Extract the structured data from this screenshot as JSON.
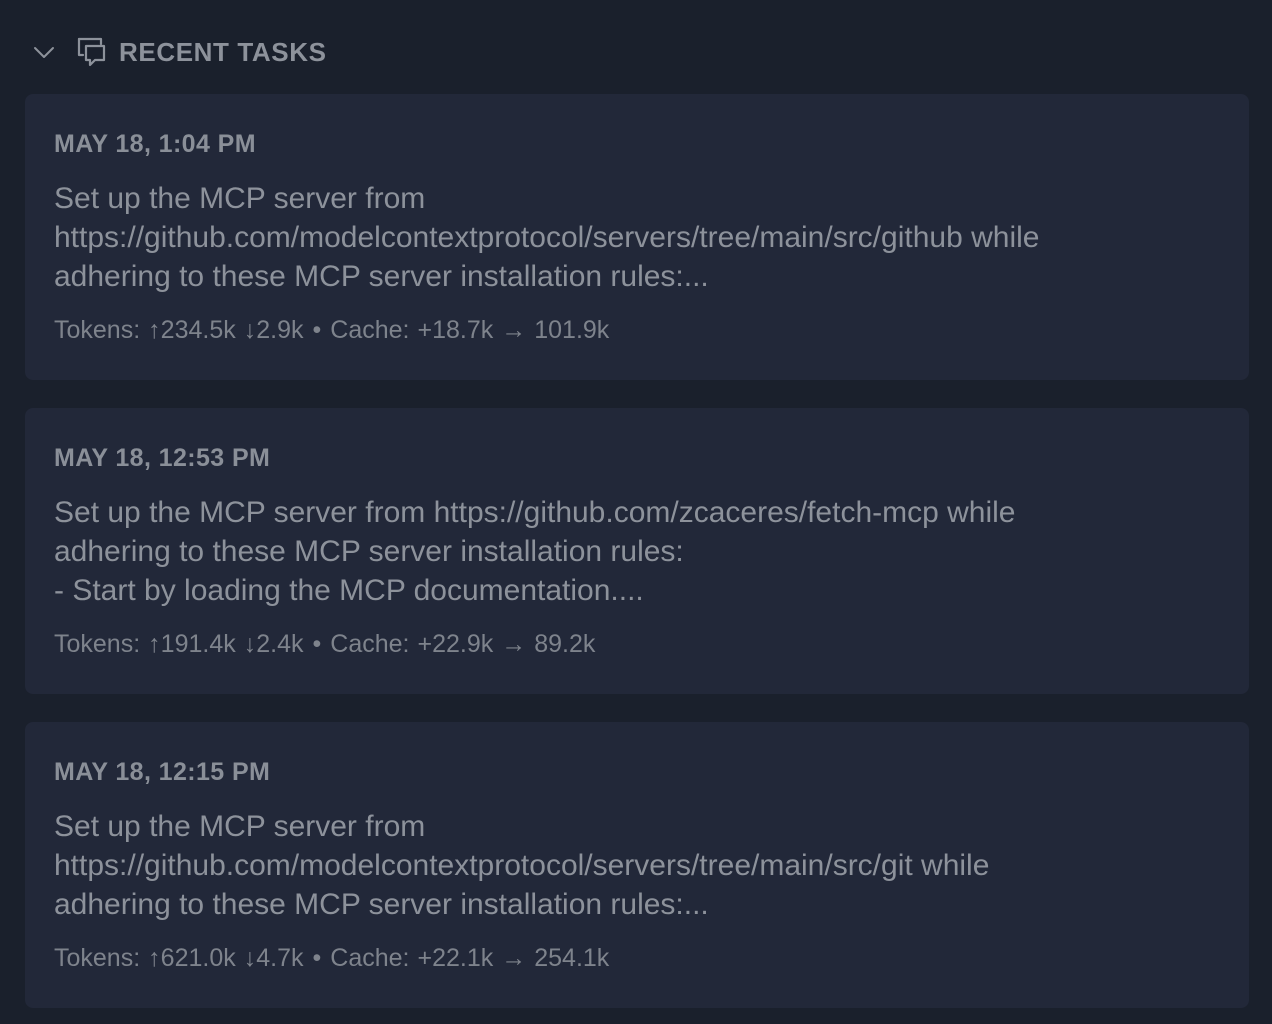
{
  "section": {
    "title": "RECENT TASKS",
    "chevron_icon": "chevron-down-icon",
    "chat_icon": "chat-bubbles-icon"
  },
  "tasks": [
    {
      "date": "MAY 18, 1:04 PM",
      "text": "Set up the MCP server from\nhttps://github.com/modelcontextprotocol/servers/tree/main/src/github while\nadhering to these MCP server installation rules:...",
      "tokens_label": "Tokens:",
      "tokens_in": "↑234.5k",
      "tokens_out": "↓2.9k",
      "separator": "•",
      "cache_label": "Cache:",
      "cache_write": "+18.7k",
      "arrow": "→",
      "cache_read": "101.9k"
    },
    {
      "date": "MAY 18, 12:53 PM",
      "text": "Set up the MCP server from https://github.com/zcaceres/fetch-mcp while\nadhering to these MCP server installation rules:\n- Start by loading the MCP documentation....",
      "tokens_label": "Tokens:",
      "tokens_in": "↑191.4k",
      "tokens_out": "↓2.4k",
      "separator": "•",
      "cache_label": "Cache:",
      "cache_write": "+22.9k",
      "arrow": "→",
      "cache_read": "89.2k"
    },
    {
      "date": "MAY 18, 12:15 PM",
      "text": "Set up the MCP server from\nhttps://github.com/modelcontextprotocol/servers/tree/main/src/git while\nadhering to these MCP server installation rules:...",
      "tokens_label": "Tokens:",
      "tokens_in": "↑621.0k",
      "tokens_out": "↓4.7k",
      "separator": "•",
      "cache_label": "Cache:",
      "cache_write": "+22.1k",
      "arrow": "→",
      "cache_read": "254.1k"
    }
  ]
}
